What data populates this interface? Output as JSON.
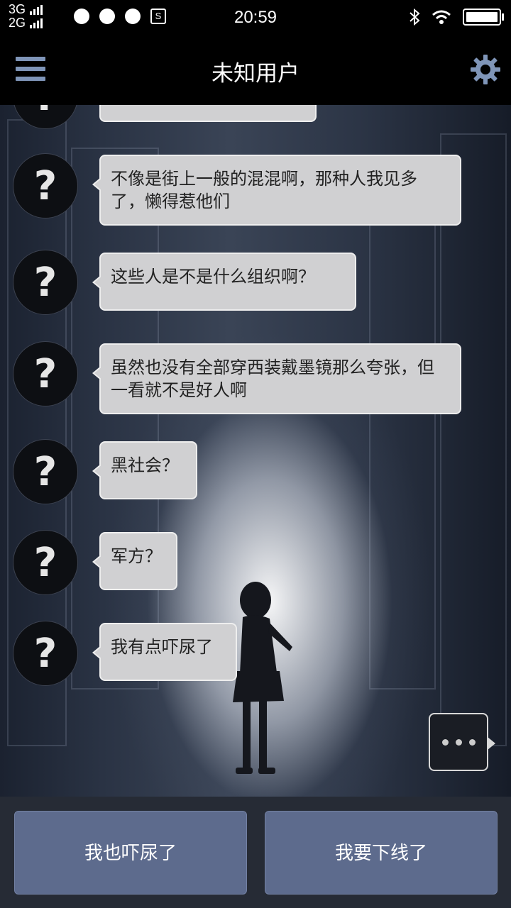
{
  "status_bar": {
    "network_1": "3G",
    "network_2": "2G",
    "time": "20:59",
    "icons": [
      "qq-icon",
      "qq-icon",
      "chat-icon",
      "s-icon",
      "bluetooth-icon",
      "wifi-icon",
      "battery-icon"
    ]
  },
  "header": {
    "title": "未知用户",
    "menu_icon": "menu-icon",
    "settings_icon": "gear-icon"
  },
  "messages": [
    {
      "avatar": "?",
      "text": "不像是街上一般的混混啊，那种人我见多了，懒得惹他们"
    },
    {
      "avatar": "?",
      "text": "这些人是不是什么组织啊？"
    },
    {
      "avatar": "?",
      "text": "虽然也没有全部穿西装戴墨镜那么夸张，但一看就不是好人啊"
    },
    {
      "avatar": "?",
      "text": "黑社会？"
    },
    {
      "avatar": "?",
      "text": "军方？"
    },
    {
      "avatar": "?",
      "text": "我有点吓尿了"
    }
  ],
  "choices": {
    "left": "我也吓尿了",
    "right": "我要下线了"
  },
  "colors": {
    "accent": "#7f95b8",
    "choice_bg": "#5d6b8d",
    "bubble_bg": "#d0d0d2"
  }
}
